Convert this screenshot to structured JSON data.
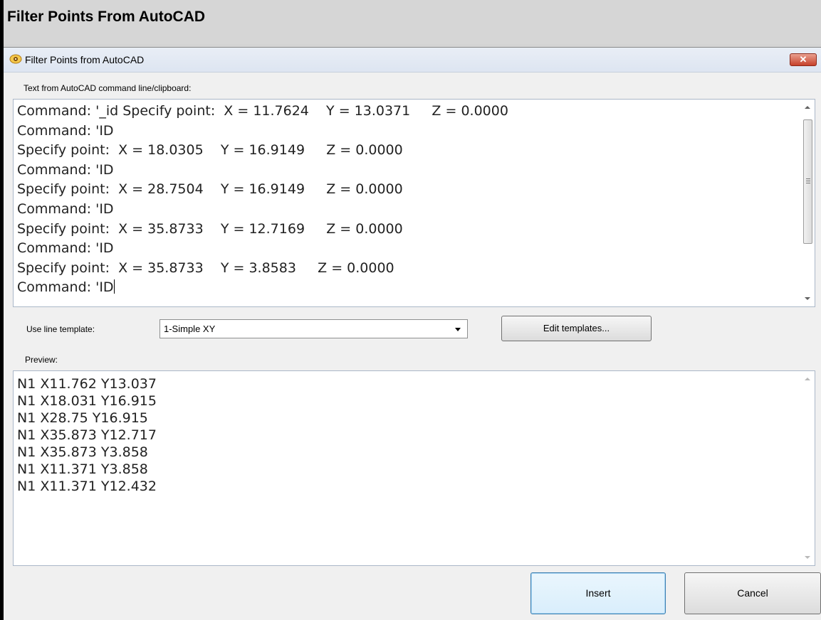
{
  "page": {
    "header_title": "Filter Points From AutoCAD"
  },
  "dialog": {
    "title": "Filter Points from AutoCAD",
    "title_icon": "autocad-eye-icon",
    "close_label": "✕"
  },
  "command_section": {
    "label": "Text from AutoCAD command line/clipboard:",
    "text": "Command: '_id Specify point:  X = 11.7624    Y = 13.0371     Z = 0.0000\nCommand: 'ID\nSpecify point:  X = 18.0305    Y = 16.9149     Z = 0.0000\nCommand: 'ID\nSpecify point:  X = 28.7504    Y = 16.9149     Z = 0.0000\nCommand: 'ID\nSpecify point:  X = 35.8733    Y = 12.7169     Z = 0.0000\nCommand: 'ID\nSpecify point:  X = 35.8733    Y = 3.8583     Z = 0.0000\nCommand: 'ID"
  },
  "template_section": {
    "label": "Use line template:",
    "selected": "1-Simple XY",
    "edit_button": "Edit templates..."
  },
  "preview_section": {
    "label": "Preview:",
    "text": "N1 X11.762 Y13.037\nN1 X18.031 Y16.915\nN1 X28.75 Y16.915\nN1 X35.873 Y12.717\nN1 X35.873 Y3.858\nN1 X11.371 Y3.858\nN1 X11.371 Y12.432"
  },
  "buttons": {
    "insert": "Insert",
    "cancel": "Cancel"
  },
  "colors": {
    "close_button": "#c7412b",
    "focus_border": "#3c7fb1"
  }
}
